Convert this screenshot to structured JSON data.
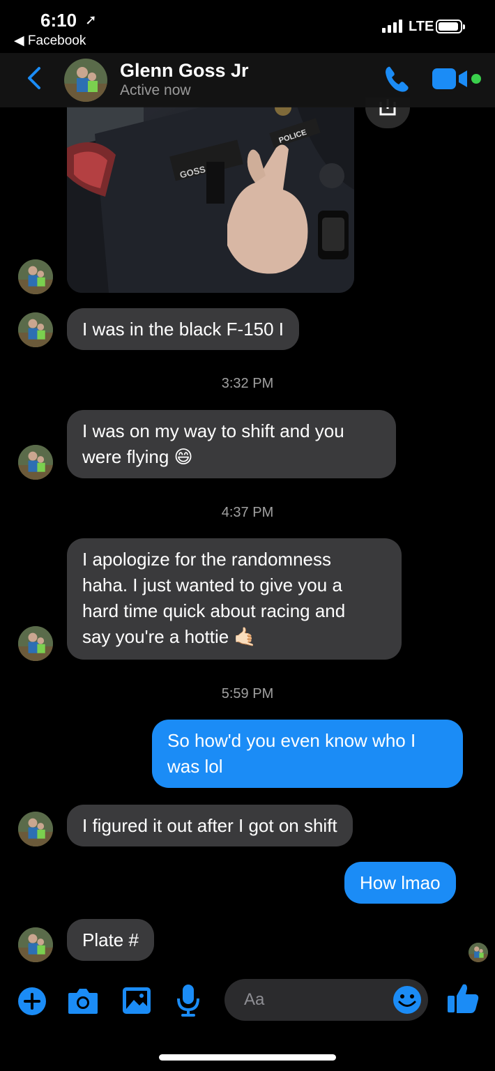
{
  "status_bar": {
    "time": "6:10",
    "network": "LTE",
    "back_app": "Facebook"
  },
  "header": {
    "contact_name": "Glenn Goss Jr",
    "status": "Active now"
  },
  "photo": {
    "name_tag": "GOSS #18",
    "patch_label": "POLICE"
  },
  "messages": [
    {
      "text": "I was in the black F-150 I"
    },
    {
      "timestamp": "3:32 PM"
    },
    {
      "line1": "I was on my way to shift and you",
      "line2": "were flying 😄"
    },
    {
      "timestamp": "4:37 PM"
    },
    {
      "line1": "I apologize for the randomness",
      "line2": "haha. I just wanted to give you a",
      "line3": "hard time quick about racing and",
      "line4": "say you're a hottie 🤙🏻"
    },
    {
      "timestamp": "5:59 PM"
    },
    {
      "line1": "So how'd you even know who I",
      "line2": "was lol"
    },
    {
      "text": "I figured it out after I got on shift"
    },
    {
      "text": "How lmao"
    },
    {
      "text": "Plate #"
    }
  ],
  "composer": {
    "placeholder": "Aa"
  },
  "icons": {
    "back": "chevron-left-icon",
    "call": "phone-icon",
    "video": "video-camera-icon",
    "plus": "plus-icon",
    "camera": "camera-icon",
    "gallery": "image-icon",
    "mic": "microphone-icon",
    "emoji": "smiley-icon",
    "like": "thumbs-up-icon"
  },
  "colors": {
    "accent": "#1b8cf6",
    "incoming_bubble": "#3a3a3c",
    "outgoing_bubble": "#1b8cf6",
    "online": "#3ad04c",
    "background": "#000000"
  }
}
